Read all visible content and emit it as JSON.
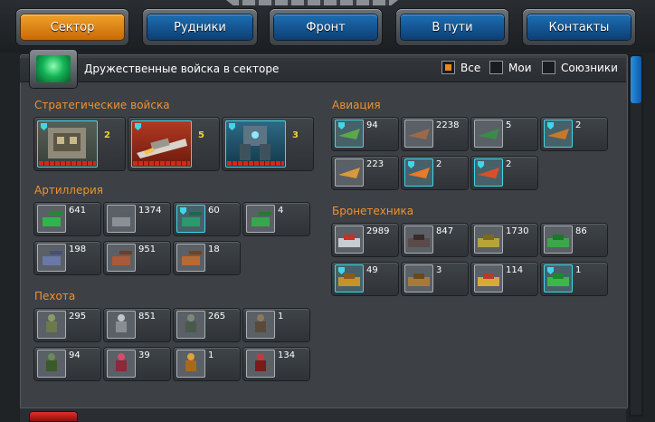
{
  "tabs": [
    {
      "label": "Сектор",
      "active": true
    },
    {
      "label": "Рудники",
      "active": false
    },
    {
      "label": "Фронт",
      "active": false
    },
    {
      "label": "В пути",
      "active": false
    },
    {
      "label": "Контакты",
      "active": false
    }
  ],
  "header": {
    "title": "Дружественные войска в секторе",
    "filters": [
      {
        "label": "Все",
        "checked": true
      },
      {
        "label": "Мои",
        "checked": false
      },
      {
        "label": "Союзники",
        "checked": false
      }
    ]
  },
  "sections": {
    "strategic": {
      "title": "Стратегические войска",
      "units": [
        {
          "count": "2",
          "icon": "fortress-unit-icon"
        },
        {
          "count": "5",
          "icon": "battleship-unit-icon"
        },
        {
          "count": "3",
          "icon": "mech-unit-icon"
        }
      ]
    },
    "artillery": {
      "title": "Артиллерия",
      "units": [
        {
          "count": "641",
          "icon": "artillery-unit-icon"
        },
        {
          "count": "1374",
          "icon": "artillery-unit-icon"
        },
        {
          "count": "60",
          "icon": "artillery-unit-icon"
        },
        {
          "count": "4",
          "icon": "artillery-unit-icon"
        },
        {
          "count": "198",
          "icon": "artillery-unit-icon"
        },
        {
          "count": "951",
          "icon": "artillery-unit-icon"
        },
        {
          "count": "18",
          "icon": "artillery-unit-icon"
        }
      ]
    },
    "infantry": {
      "title": "Пехота",
      "units": [
        {
          "count": "295",
          "icon": "infantry-unit-icon"
        },
        {
          "count": "851",
          "icon": "infantry-unit-icon"
        },
        {
          "count": "265",
          "icon": "infantry-unit-icon"
        },
        {
          "count": "1",
          "icon": "infantry-unit-icon"
        },
        {
          "count": "94",
          "icon": "infantry-unit-icon"
        },
        {
          "count": "39",
          "icon": "infantry-unit-icon"
        },
        {
          "count": "1",
          "icon": "infantry-unit-icon"
        },
        {
          "count": "134",
          "icon": "infantry-unit-icon"
        }
      ]
    },
    "aviation": {
      "title": "Авиация",
      "units": [
        {
          "count": "94",
          "icon": "aircraft-unit-icon"
        },
        {
          "count": "2238",
          "icon": "aircraft-unit-icon"
        },
        {
          "count": "5",
          "icon": "aircraft-unit-icon"
        },
        {
          "count": "2",
          "icon": "aircraft-unit-icon"
        },
        {
          "count": "223",
          "icon": "aircraft-unit-icon"
        },
        {
          "count": "2",
          "icon": "aircraft-unit-icon"
        },
        {
          "count": "2",
          "icon": "aircraft-unit-icon"
        }
      ]
    },
    "armor": {
      "title": "Бронетехника",
      "units": [
        {
          "count": "2989",
          "icon": "tank-unit-icon"
        },
        {
          "count": "847",
          "icon": "tank-unit-icon"
        },
        {
          "count": "1730",
          "icon": "tank-unit-icon"
        },
        {
          "count": "86",
          "icon": "tank-unit-icon"
        },
        {
          "count": "49",
          "icon": "tank-unit-icon"
        },
        {
          "count": "3",
          "icon": "tank-unit-icon"
        },
        {
          "count": "114",
          "icon": "tank-unit-icon"
        },
        {
          "count": "1",
          "icon": "tank-unit-icon"
        }
      ]
    }
  },
  "colors": {
    "accent": "#f0912c",
    "active_tab": "#e8891a",
    "tab": "#0f4f8f",
    "count_strategic": "#f5d12a"
  }
}
